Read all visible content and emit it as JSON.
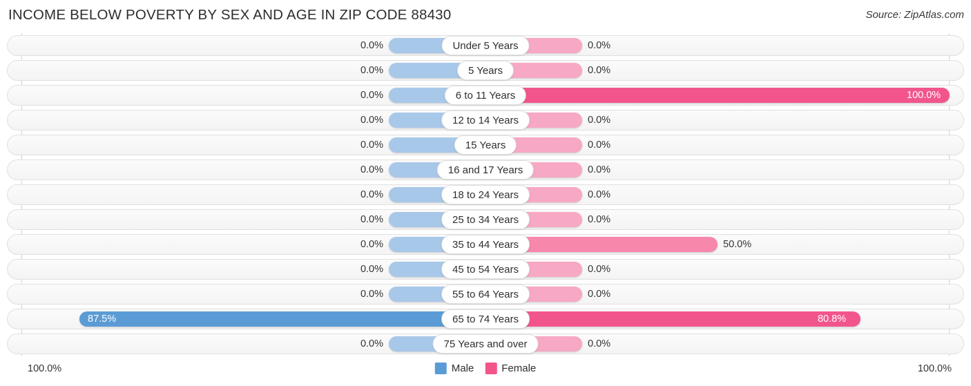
{
  "header": {
    "title": "INCOME BELOW POVERTY BY SEX AND AGE IN ZIP CODE 88430",
    "source": "Source: ZipAtlas.com"
  },
  "legend": {
    "male_label": "Male",
    "female_label": "Female",
    "male_color": "#5b9bd5",
    "female_color": "#f2558c"
  },
  "axis": {
    "left_end": "100.0%",
    "right_end": "100.0%"
  },
  "chart_data": {
    "type": "bar",
    "subtype": "diverging-horizontal-bar",
    "title": "INCOME BELOW POVERTY BY SEX AND AGE IN ZIP CODE 88430",
    "xlabel": "",
    "ylabel": "",
    "xlim": [
      0,
      100
    ],
    "grid": false,
    "legend_position": "bottom-center",
    "categories": [
      "Under 5 Years",
      "5 Years",
      "6 to 11 Years",
      "12 to 14 Years",
      "15 Years",
      "16 and 17 Years",
      "18 to 24 Years",
      "25 to 34 Years",
      "35 to 44 Years",
      "45 to 54 Years",
      "55 to 64 Years",
      "65 to 74 Years",
      "75 Years and over"
    ],
    "series": [
      {
        "name": "Male",
        "values": [
          0.0,
          0.0,
          0.0,
          0.0,
          0.0,
          0.0,
          0.0,
          0.0,
          0.0,
          0.0,
          0.0,
          87.5,
          0.0
        ],
        "labels": [
          "0.0%",
          "0.0%",
          "0.0%",
          "0.0%",
          "0.0%",
          "0.0%",
          "0.0%",
          "0.0%",
          "0.0%",
          "0.0%",
          "0.0%",
          "87.5%",
          "0.0%"
        ]
      },
      {
        "name": "Female",
        "values": [
          0.0,
          0.0,
          100.0,
          0.0,
          0.0,
          0.0,
          0.0,
          0.0,
          50.0,
          0.0,
          0.0,
          80.8,
          0.0
        ],
        "labels": [
          "0.0%",
          "0.0%",
          "100.0%",
          "0.0%",
          "0.0%",
          "0.0%",
          "0.0%",
          "0.0%",
          "50.0%",
          "0.0%",
          "0.0%",
          "80.8%",
          "0.0%"
        ]
      }
    ]
  }
}
